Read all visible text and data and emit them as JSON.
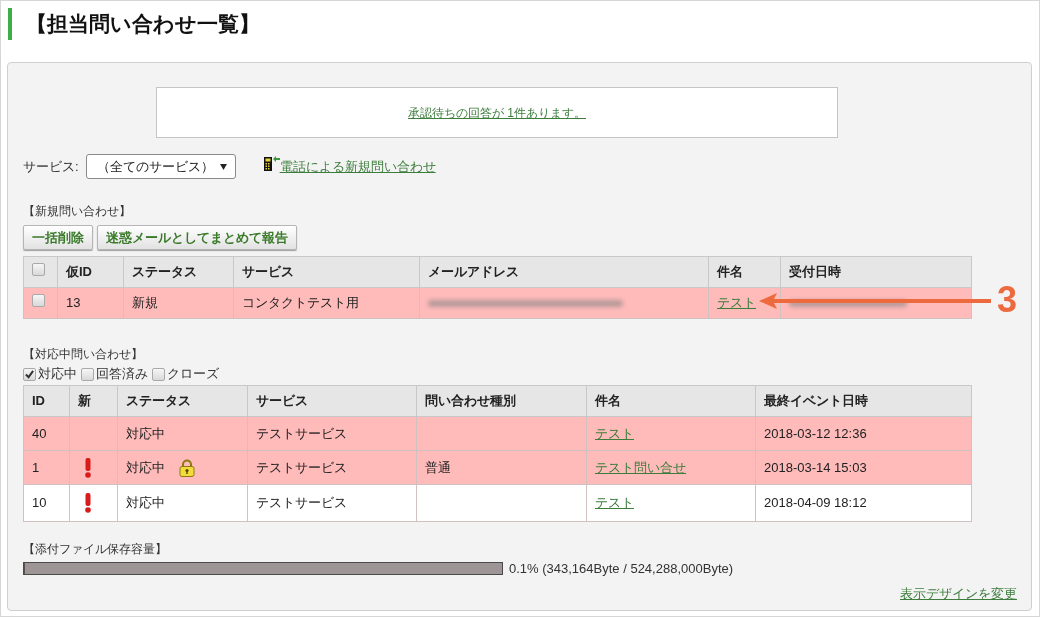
{
  "page_title": "【担当問い合わせ一覧】",
  "notice": {
    "link": "承認待ちの回答が 1件あります。"
  },
  "service_filter": {
    "label": "サービス:",
    "value": "（全てのサービス）"
  },
  "phone_inquiry_link": "電話による新規問い合わせ",
  "new_inquiries": {
    "heading": "【新規問い合わせ】",
    "buttons": [
      "一括削除",
      "迷惑メールとしてまとめて報告"
    ],
    "select_all_checked": false,
    "columns": [
      "仮ID",
      "ステータス",
      "サービス",
      "メールアドレス",
      "件名",
      "受付日時"
    ],
    "rows": [
      {
        "checked": false,
        "highlighted": true,
        "temp_id": "13",
        "status": "新規",
        "service": "コンタクトテスト用",
        "email_blurred": true,
        "subject": "テスト",
        "received_blurred": true
      }
    ]
  },
  "annotation": {
    "label": "3"
  },
  "in_progress": {
    "heading": "【対応中問い合わせ】",
    "filters": [
      {
        "label": "対応中",
        "checked": true
      },
      {
        "label": "回答済み",
        "checked": false
      },
      {
        "label": "クローズ",
        "checked": false
      }
    ],
    "columns": [
      "ID",
      "新",
      "ステータス",
      "サービス",
      "問い合わせ種別",
      "件名",
      "最終イベント日時"
    ],
    "rows": [
      {
        "highlighted": true,
        "id": "40",
        "new": false,
        "status": "対応中",
        "locked": false,
        "service": "テストサービス",
        "subject": "テスト",
        "last_event": "2018-03-12 12:36"
      },
      {
        "highlighted": true,
        "id": "1",
        "new": true,
        "status": "対応中",
        "locked": true,
        "service": "テストサービス",
        "type": "普通",
        "subject": "テスト問い合せ",
        "last_event": "2018-03-14 15:03"
      },
      {
        "highlighted": false,
        "id": "10",
        "new": true,
        "status": "対応中",
        "locked": false,
        "service": "テストサービス",
        "subject": "テスト",
        "last_event": "2018-04-09 18:12"
      }
    ]
  },
  "storage": {
    "heading": "【添付ファイル保存容量】",
    "level": 0.001,
    "reading": "0.1% (343,164Byte / 524,288,000Byte)"
  },
  "design_link": "表示デザインを変更"
}
